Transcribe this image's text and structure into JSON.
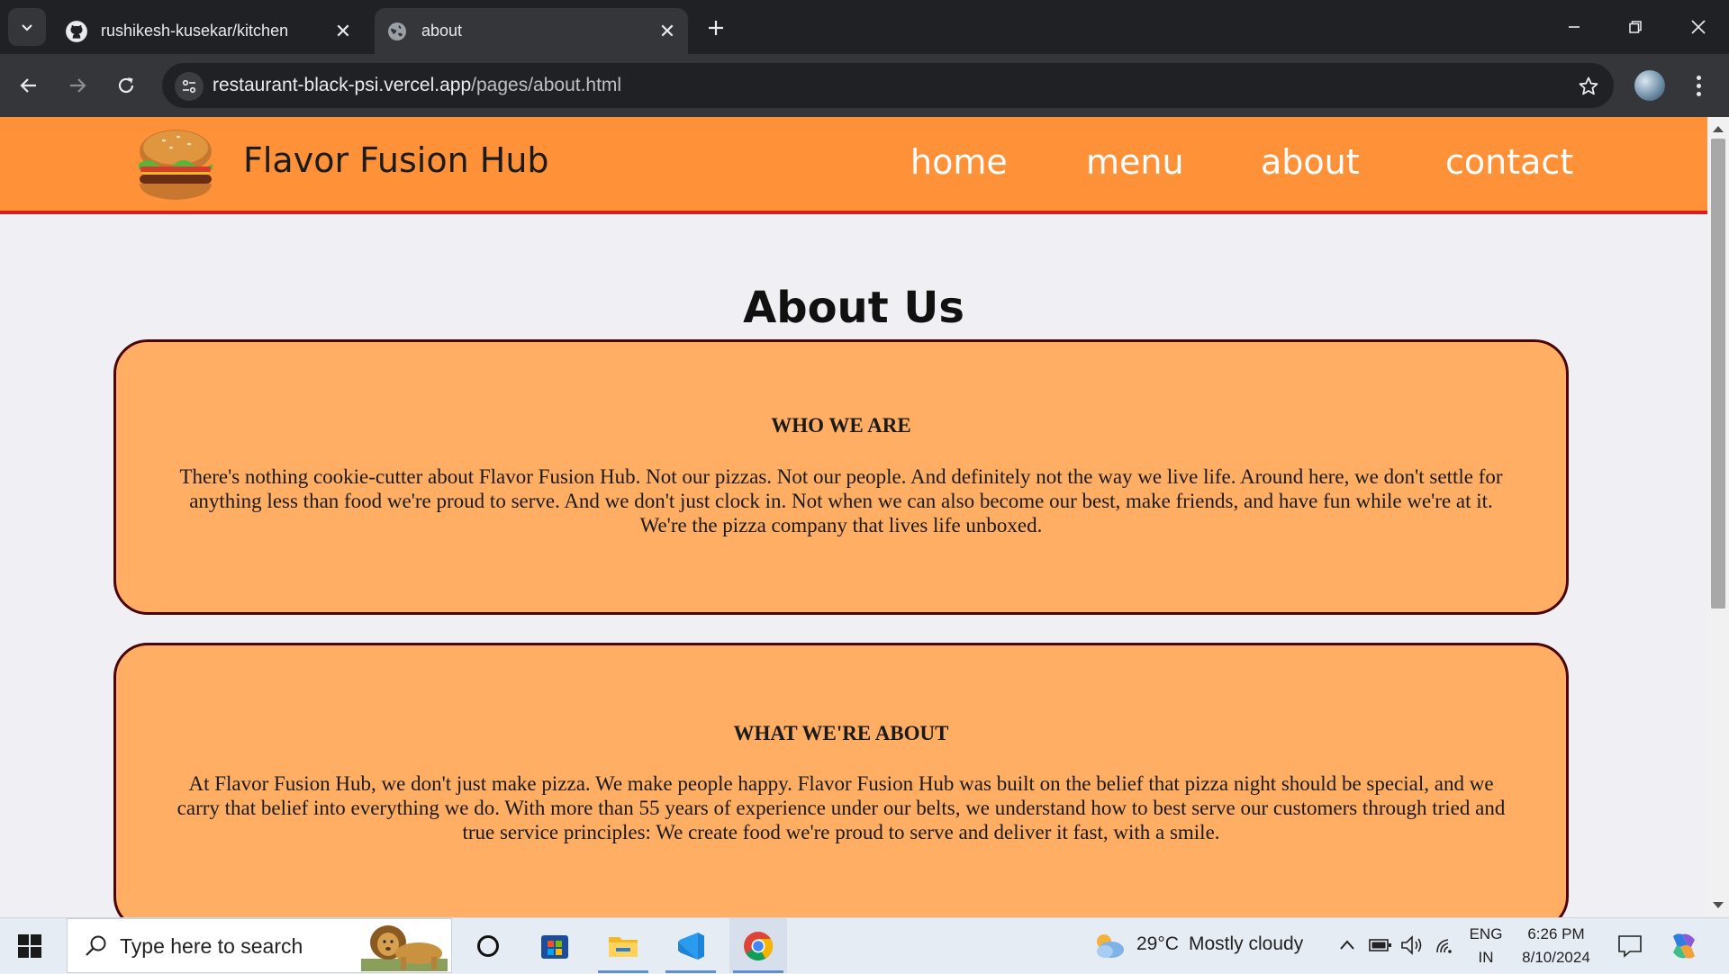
{
  "browser": {
    "tabs": [
      {
        "title": "rushikesh-kusekar/kitchen",
        "favicon": "github-icon",
        "active": false
      },
      {
        "title": "about",
        "favicon": "globe-icon",
        "active": true
      }
    ],
    "url_host": "restaurant-black-psi.vercel.app",
    "url_path": "/pages/about.html"
  },
  "site": {
    "brand": "Flavor Fusion Hub",
    "logo": "burger-logo",
    "nav": [
      "home",
      "menu",
      "about",
      "contact"
    ],
    "colors": {
      "header": "#ff9138",
      "card": "#ffae63",
      "card_border": "#4a0508",
      "header_border": "#d81f1f"
    }
  },
  "about": {
    "title": "About Us",
    "sections": [
      {
        "heading": "WHO WE ARE",
        "text": "There's nothing cookie-cutter about Flavor Fusion Hub. Not our pizzas. Not our people. And definitely not the way we live life. Around here, we don't settle for anything less than food we're proud to serve. And we don't just clock in. Not when we can also become our best, make friends, and have fun while we're at it. We're the pizza company that lives life unboxed."
      },
      {
        "heading": "WHAT WE'RE ABOUT",
        "text": "At Flavor Fusion Hub, we don't just make pizza. We make people happy. Flavor Fusion Hub was built on the belief that pizza night should be special, and we carry that belief into everything we do. With more than 55 years of experience under our belts, we understand how to best serve our customers through tried and true service principles: We create food we're proud to serve and deliver it fast, with a smile."
      }
    ]
  },
  "taskbar": {
    "search_placeholder": "Type here to search",
    "apps": [
      "cortana-icon",
      "microsoft-store-icon",
      "file-explorer-icon",
      "vscode-icon",
      "chrome-icon"
    ],
    "weather_temp": "29°C",
    "weather_text": "Mostly cloudy",
    "lang_top": "ENG",
    "lang_bottom": "IN",
    "time": "6:26 PM",
    "date": "8/10/2024"
  }
}
